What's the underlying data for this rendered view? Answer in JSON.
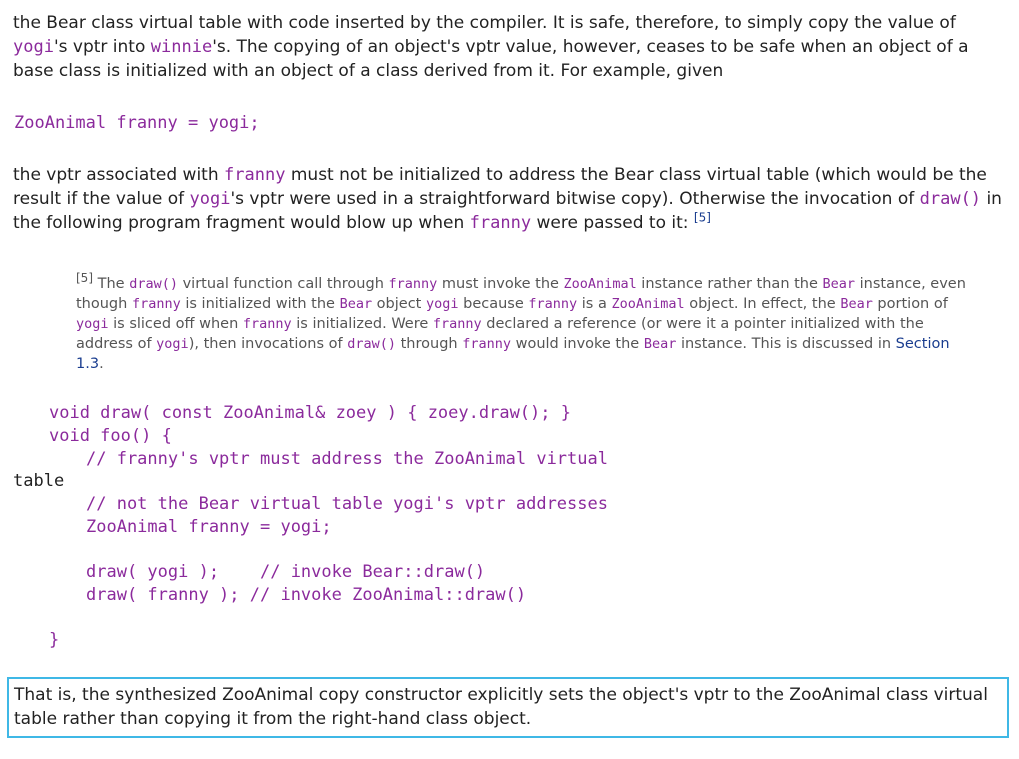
{
  "para1": {
    "t1": "the Bear class virtual table with code inserted by the compiler. It is safe, therefore, to simply copy the value of ",
    "c1": "yogi",
    "t2": "'s vptr into ",
    "c2": "winnie",
    "t3": "'s. The copying of an object's vptr value, however, ceases to be safe when an object of a base class is initialized with an object of a class derived from it. For example, given"
  },
  "code1": {
    "line": "ZooAnimal franny = yogi;"
  },
  "para2": {
    "t1": "the vptr associated with ",
    "c1": "franny",
    "t2": " must not be initialized to address the Bear class virtual table (which would be the result if the value of ",
    "c2": "yogi",
    "t3": "'s vptr were used in a straightforward bitwise copy). Otherwise the invocation of ",
    "c3": "draw()",
    "t4": " in the following program fragment would blow up when ",
    "c4": "franny",
    "t5": " were passed to it: ",
    "ref": "[5]"
  },
  "footnote": {
    "mark": "[5]",
    "t1": " The ",
    "c1": "draw()",
    "t2": " virtual function call through ",
    "c2": "franny",
    "t3": " must invoke the ",
    "c3": "ZooAnimal",
    "t4": " instance rather than the ",
    "c4": "Bear",
    "t5": " instance, even though ",
    "c5": "franny",
    "t6": " is initialized with the ",
    "c6": "Bear",
    "t7": " object ",
    "c7": "yogi",
    "t8": " because ",
    "c8": "franny",
    "t9": " is a ",
    "c9": "ZooAnimal",
    "t10": " object. In effect, the ",
    "c10": "Bear",
    "t11": " portion of ",
    "c11": "yogi",
    "t12": " is sliced off when ",
    "c12": "franny",
    "t13": " is initialized. Were ",
    "c13": "franny",
    "t14": " declared a reference (or were it a pointer initialized with the address of ",
    "c14": "yogi",
    "t15": "), then invocations of ",
    "c15": "draw()",
    "t16": " through ",
    "c16": "franny",
    "t17": " would invoke the ",
    "c17": "Bear",
    "t18": " instance. This is discussed in ",
    "link": "Section 1.3",
    "t19": "."
  },
  "code2": {
    "l1": "void draw( const ZooAnimal& zoey ) { zoey.draw(); }",
    "l2": "void foo() {",
    "l3": "// franny's vptr must address the ZooAnimal virtual",
    "l4": "table",
    "l5": "// not the Bear virtual table yogi's vptr addresses",
    "l6": "ZooAnimal franny = yogi;",
    "l7": "draw( yogi );    // invoke Bear::draw()",
    "l8": "draw( franny ); // invoke ZooAnimal::draw()",
    "l9": "}"
  },
  "highlight": {
    "text": "That is, the synthesized ZooAnimal copy constructor explicitly sets the object's vptr to the ZooAnimal class virtual table rather than copying it from the right-hand class object."
  },
  "colors": {
    "code": "#8b2a9c",
    "link": "#1a3d8f",
    "highlight_border": "#3fb8e6"
  }
}
